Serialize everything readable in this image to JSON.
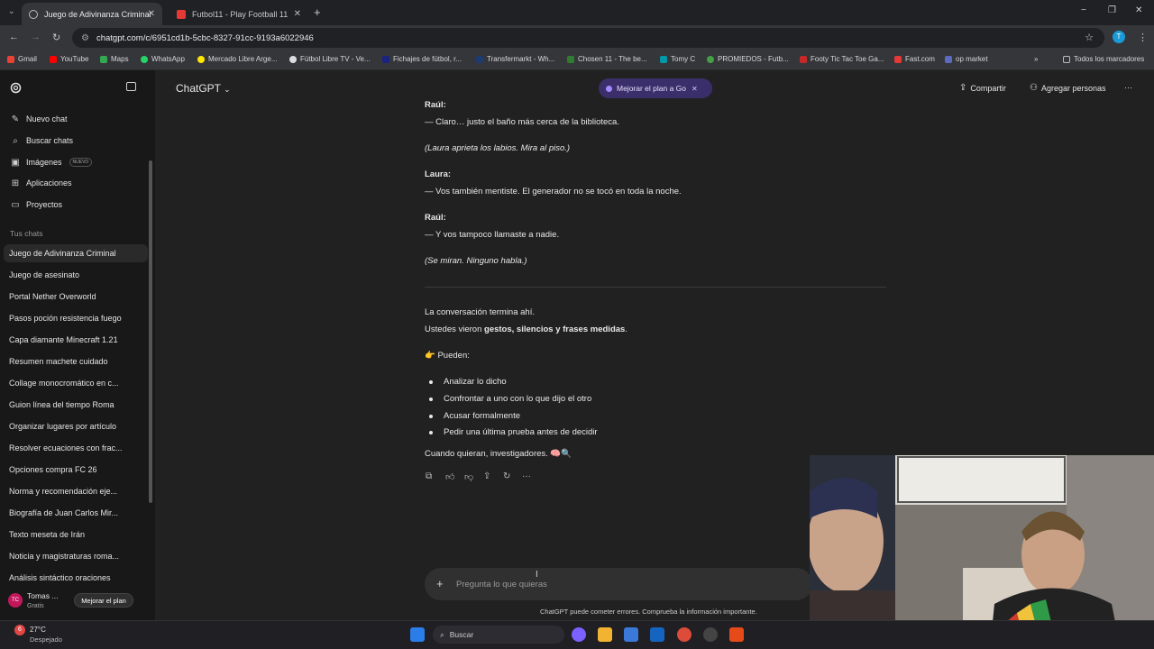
{
  "browser": {
    "tabs": [
      {
        "title": "Juego de Adivinanza Criminal",
        "active": true
      },
      {
        "title": "Futbol11 - Play Football 11",
        "active": false
      }
    ],
    "new_tab": "+",
    "window_controls": [
      "−",
      "❐",
      "✕"
    ],
    "url": "chatgpt.com/c/6951cd1b-5cbc-8327-91cc-9193a6022946",
    "profile_initial": "T",
    "bookmarks": [
      "Gmail",
      "YouTube",
      "Maps",
      "WhatsApp",
      "Mercado Libre Arge...",
      "Fútbol Libre TV - Ve...",
      "Fichajes de fútbol, r...",
      "Transfermarkt - Wh...",
      "Chosen 11 - The be...",
      "Tomy C",
      "PROMIEDOS - Futb...",
      "Footy Tic Tac Toe Ga...",
      "Fast.com",
      "op market"
    ],
    "bookmarks_more": "»",
    "all_bookmarks": "Todos los marcadores"
  },
  "sidebar": {
    "nav": [
      {
        "label": "Nuevo chat",
        "icon": "edit-icon"
      },
      {
        "label": "Buscar chats",
        "icon": "search-icon"
      },
      {
        "label": "Imágenes",
        "icon": "image-icon",
        "badge": "NUEVO"
      },
      {
        "label": "Aplicaciones",
        "icon": "apps-icon"
      },
      {
        "label": "Proyectos",
        "icon": "folder-icon"
      }
    ],
    "section_title": "Tus chats",
    "chats": [
      "Juego de Adivinanza Criminal",
      "Juego de asesinato",
      "Portal Nether Overworld",
      "Pasos poción resistencia fuego",
      "Capa diamante Minecraft 1.21",
      "Resumen machete cuidado",
      "Collage monocromático en c...",
      "Guion línea del tiempo Roma",
      "Organizar lugares por artículo",
      "Resolver ecuaciones con frac...",
      "Opciones compra FC 26",
      "Norma y recomendación eje...",
      "Biografía de Juan Carlos Mir...",
      "Texto meseta de Irán",
      "Noticia y magistraturas roma...",
      "Análisis sintáctico oraciones"
    ],
    "user": {
      "initials": "TC",
      "name": "Tomas ...",
      "plan": "Gratis",
      "upgrade": "Mejorar el plan"
    }
  },
  "header": {
    "model": "ChatGPT",
    "promo": "Mejorar el plan a Go",
    "share": "Compartir",
    "add_people": "Agregar personas",
    "more": "···"
  },
  "conversation": {
    "lines": [
      {
        "text": "Raúl:",
        "style": "b"
      },
      {
        "text": "— Claro… justo el baño más cerca de la biblioteca.",
        "style": ""
      },
      {
        "text": "(Laura aprieta los labios. Mira al piso.)",
        "style": "i"
      },
      {
        "text": "Laura:",
        "style": "b"
      },
      {
        "text": "— Vos también mentiste. El generador no se tocó en toda la noche.",
        "style": ""
      },
      {
        "text": "Raúl:",
        "style": "b"
      },
      {
        "text": "— Y vos tampoco llamaste a nadie.",
        "style": ""
      },
      {
        "text": "(Se miran. Ninguno habla.)",
        "style": "i"
      },
      {
        "text": "La conversación termina ahí.",
        "style": ""
      }
    ],
    "seen_prefix": "Ustedes vieron ",
    "seen_bold": "gestos, silencios y frases medidas",
    "seen_suffix": ".",
    "can_label": "👉 Pueden:",
    "options": [
      "Analizar lo dicho",
      "Confrontar a uno con lo que dijo el otro",
      "Acusar formalmente",
      "Pedir una última prueba antes de decidir"
    ],
    "closing": "Cuando quieran, investigadores. 🧠🔍"
  },
  "composer": {
    "plus": "+",
    "placeholder": "Pregunta lo que quieras",
    "disclaimer": "ChatGPT puede cometer errores. Comprueba la información importante."
  },
  "taskbar": {
    "temp": "27°C",
    "weather": "Despejado",
    "weather_badge": "6",
    "search": "Buscar"
  }
}
